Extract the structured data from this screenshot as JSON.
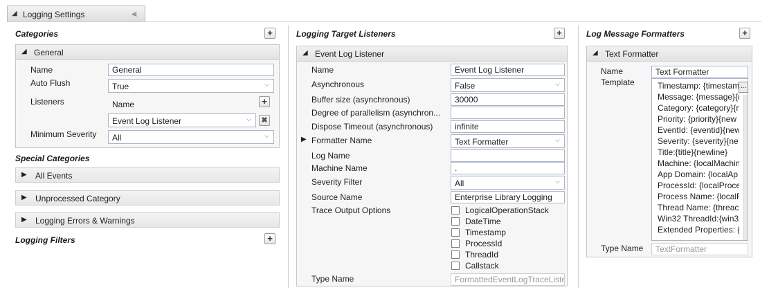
{
  "title_tab": {
    "label": "Logging Settings"
  },
  "categories": {
    "header": "Categories",
    "general": {
      "title": "General",
      "name_label": "Name",
      "name_value": "General",
      "autoflush_label": "Auto Flush",
      "autoflush_value": "True",
      "listeners_label": "Listeners",
      "listeners_header": "Name",
      "listener_value": "Event Log Listener",
      "minsev_label": "Minimum Severity",
      "minsev_value": "All"
    },
    "special_header": "Special Categories",
    "special_items": [
      "All Events",
      "Unprocessed Category",
      "Logging Errors & Warnings"
    ],
    "filters_header": "Logging Filters"
  },
  "listeners": {
    "header": "Logging Target Listeners",
    "item_title": "Event Log Listener",
    "props": [
      {
        "label": "Name",
        "value": "Event Log Listener",
        "kind": "text"
      },
      {
        "label": "Asynchronous",
        "value": "False",
        "kind": "dropdown"
      },
      {
        "label": "Buffer size (asynchronous)",
        "value": "30000",
        "kind": "text"
      },
      {
        "label": "Degree of parallelism (asynchron...",
        "value": "",
        "kind": "text"
      },
      {
        "label": "Dispose Timeout (asynchronous)",
        "value": "infinite",
        "kind": "text"
      },
      {
        "label": "Formatter Name",
        "value": "Text Formatter",
        "kind": "dropdown"
      },
      {
        "label": "Log Name",
        "value": "",
        "kind": "text"
      },
      {
        "label": "Machine Name",
        "value": ".",
        "kind": "text"
      },
      {
        "label": "Severity Filter",
        "value": "All",
        "kind": "dropdown"
      },
      {
        "label": "Source Name",
        "value": "Enterprise Library Logging",
        "kind": "text"
      }
    ],
    "trace_label": "Trace Output Options",
    "trace_options": [
      "LogicalOperationStack",
      "DateTime",
      "Timestamp",
      "ProcessId",
      "ThreadId",
      "Callstack"
    ],
    "type_label": "Type Name",
    "type_value": "FormattedEventLogTraceListe"
  },
  "formatters": {
    "header": "Log Message Formatters",
    "item_title": "Text Formatter",
    "name_label": "Name",
    "name_value": "Text Formatter",
    "template_label": "Template",
    "template_lines": [
      "Timestamp: {timestam",
      "Message: {message}{n",
      "Category: {category}{n",
      "Priority: {priority}{new",
      "EventId: {eventid}{new",
      "Severity: {severity}{ne",
      "Title:{title}{newline}",
      "Machine: {localMachin",
      "App Domain: {localAp",
      "ProcessId: {localProce",
      "Process Name: {localP",
      "Thread Name: {threac",
      "Win32 ThreadId:{win3",
      "Extended Properties: {"
    ],
    "ellipsis": "...",
    "type_label": "Type Name",
    "type_value": "TextFormatter"
  },
  "icons": {
    "plus": "+",
    "remove": "✖",
    "dropdown": "⌄",
    "collapse": "⌄⌄"
  }
}
